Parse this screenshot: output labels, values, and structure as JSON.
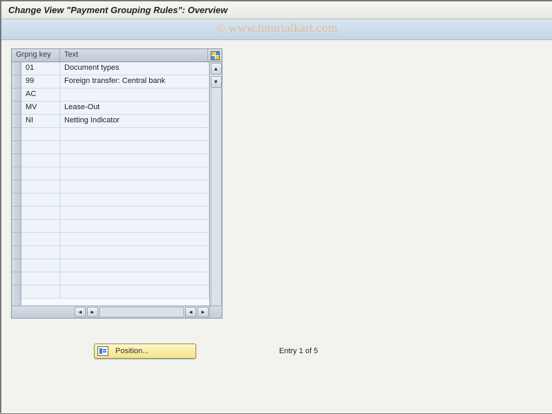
{
  "title": "Change View \"Payment Grouping Rules\": Overview",
  "watermark": "© www.tutorialkart.com",
  "table": {
    "columns": {
      "key": "Grpng key",
      "text": "Text"
    },
    "rows": [
      {
        "key": "01",
        "text": "Document types"
      },
      {
        "key": "99",
        "text": "Foreign transfer: Central bank"
      },
      {
        "key": "AC",
        "text": ""
      },
      {
        "key": "MV",
        "text": "Lease-Out"
      },
      {
        "key": "NI",
        "text": "Netting Indicator"
      }
    ]
  },
  "position_button": "Position...",
  "entry_text": "Entry 1 of 5"
}
